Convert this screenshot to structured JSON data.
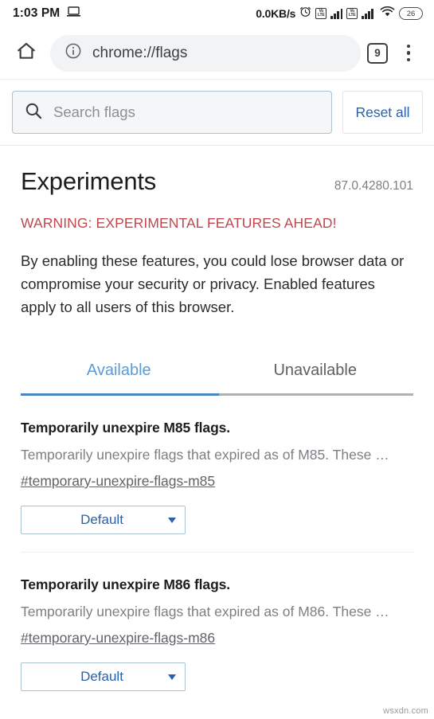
{
  "statusbar": {
    "time": "1:03 PM",
    "cast_icon": "laptop-icon",
    "network_speed": "0.0KB/s",
    "alarm_icon": "alarm-clock-icon",
    "volte_line1": "Vo",
    "volte_line2": "LTE",
    "wifi_icon": "wifi-icon",
    "battery_level": "26"
  },
  "toolbar": {
    "home_icon": "home-icon",
    "site_info_icon": "info-circle-icon",
    "url": "chrome://flags",
    "tab_count": "9",
    "menu_icon": "overflow-menu-icon"
  },
  "search": {
    "icon": "search-icon",
    "placeholder": "Search flags",
    "value": "",
    "reset_label": "Reset all"
  },
  "main": {
    "title": "Experiments",
    "version": "87.0.4280.101",
    "warning": "WARNING: EXPERIMENTAL FEATURES AHEAD!",
    "blurb": "By enabling these features, you could lose browser data or compromise your security or privacy. Enabled features apply to all users of this browser.",
    "tabs": [
      {
        "label": "Available",
        "active": true
      },
      {
        "label": "Unavailable",
        "active": false
      }
    ],
    "flags": [
      {
        "title": "Temporarily unexpire M85 flags.",
        "description": "Temporarily unexpire flags that expired as of M85. These …",
        "anchor": "#temporary-unexpire-flags-m85",
        "select_value": "Default"
      },
      {
        "title": "Temporarily unexpire M86 flags.",
        "description": "Temporarily unexpire flags that expired as of M86. These …",
        "anchor": "#temporary-unexpire-flags-m86",
        "select_value": "Default"
      }
    ]
  },
  "watermark": "wsxdn.com",
  "colors": {
    "accent_blue": "#2a61a8",
    "tab_active": "#5b9bd5",
    "warning_red": "#c0474c",
    "omnibox_bg": "#f1f3f4"
  }
}
